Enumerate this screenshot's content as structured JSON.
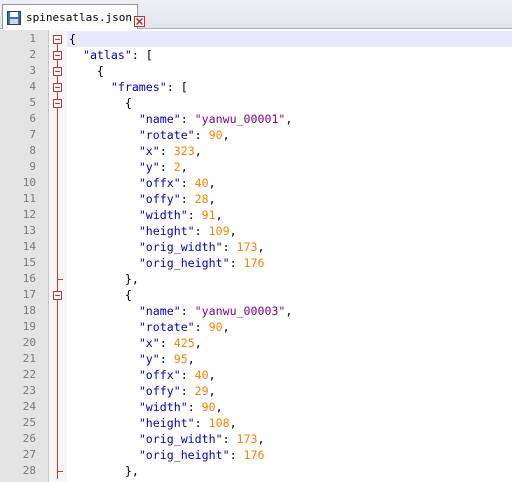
{
  "tab": {
    "filename": "spinesatlas.json",
    "icon": "save-disk-icon",
    "close_icon": "close-x-icon"
  },
  "colors": {
    "key": "#0000c8",
    "string": "#7f007f",
    "number": "#ff7f00",
    "fold": "#e03030"
  },
  "lines": [
    {
      "n": "1",
      "tokens": [
        {
          "t": "{",
          "c": "p"
        }
      ]
    },
    {
      "n": "2",
      "tokens": [
        {
          "t": "  ",
          "c": "p"
        },
        {
          "t": "\"atlas\"",
          "c": "k"
        },
        {
          "t": ": [",
          "c": "p"
        }
      ]
    },
    {
      "n": "3",
      "tokens": [
        {
          "t": "    {",
          "c": "p"
        }
      ]
    },
    {
      "n": "4",
      "tokens": [
        {
          "t": "      ",
          "c": "p"
        },
        {
          "t": "\"frames\"",
          "c": "k"
        },
        {
          "t": ": [",
          "c": "p"
        }
      ]
    },
    {
      "n": "5",
      "tokens": [
        {
          "t": "        {",
          "c": "p"
        }
      ]
    },
    {
      "n": "6",
      "tokens": [
        {
          "t": "          ",
          "c": "p"
        },
        {
          "t": "\"name\"",
          "c": "k"
        },
        {
          "t": ": ",
          "c": "p"
        },
        {
          "t": "\"yanwu_00001\"",
          "c": "s"
        },
        {
          "t": ",",
          "c": "p"
        }
      ]
    },
    {
      "n": "7",
      "tokens": [
        {
          "t": "          ",
          "c": "p"
        },
        {
          "t": "\"rotate\"",
          "c": "k"
        },
        {
          "t": ": ",
          "c": "p"
        },
        {
          "t": "90",
          "c": "n"
        },
        {
          "t": ",",
          "c": "p"
        }
      ]
    },
    {
      "n": "8",
      "tokens": [
        {
          "t": "          ",
          "c": "p"
        },
        {
          "t": "\"x\"",
          "c": "k"
        },
        {
          "t": ": ",
          "c": "p"
        },
        {
          "t": "323",
          "c": "n"
        },
        {
          "t": ",",
          "c": "p"
        }
      ]
    },
    {
      "n": "9",
      "tokens": [
        {
          "t": "          ",
          "c": "p"
        },
        {
          "t": "\"y\"",
          "c": "k"
        },
        {
          "t": ": ",
          "c": "p"
        },
        {
          "t": "2",
          "c": "n"
        },
        {
          "t": ",",
          "c": "p"
        }
      ]
    },
    {
      "n": "10",
      "tokens": [
        {
          "t": "          ",
          "c": "p"
        },
        {
          "t": "\"offx\"",
          "c": "k"
        },
        {
          "t": ": ",
          "c": "p"
        },
        {
          "t": "40",
          "c": "n"
        },
        {
          "t": ",",
          "c": "p"
        }
      ]
    },
    {
      "n": "11",
      "tokens": [
        {
          "t": "          ",
          "c": "p"
        },
        {
          "t": "\"offy\"",
          "c": "k"
        },
        {
          "t": ": ",
          "c": "p"
        },
        {
          "t": "28",
          "c": "n"
        },
        {
          "t": ",",
          "c": "p"
        }
      ]
    },
    {
      "n": "12",
      "tokens": [
        {
          "t": "          ",
          "c": "p"
        },
        {
          "t": "\"width\"",
          "c": "k"
        },
        {
          "t": ": ",
          "c": "p"
        },
        {
          "t": "91",
          "c": "n"
        },
        {
          "t": ",",
          "c": "p"
        }
      ]
    },
    {
      "n": "13",
      "tokens": [
        {
          "t": "          ",
          "c": "p"
        },
        {
          "t": "\"height\"",
          "c": "k"
        },
        {
          "t": ": ",
          "c": "p"
        },
        {
          "t": "109",
          "c": "n"
        },
        {
          "t": ",",
          "c": "p"
        }
      ]
    },
    {
      "n": "14",
      "tokens": [
        {
          "t": "          ",
          "c": "p"
        },
        {
          "t": "\"orig_width\"",
          "c": "k"
        },
        {
          "t": ": ",
          "c": "p"
        },
        {
          "t": "173",
          "c": "n"
        },
        {
          "t": ",",
          "c": "p"
        }
      ]
    },
    {
      "n": "15",
      "tokens": [
        {
          "t": "          ",
          "c": "p"
        },
        {
          "t": "\"orig_height\"",
          "c": "k"
        },
        {
          "t": ": ",
          "c": "p"
        },
        {
          "t": "176",
          "c": "n"
        }
      ]
    },
    {
      "n": "16",
      "tokens": [
        {
          "t": "        },",
          "c": "p"
        }
      ]
    },
    {
      "n": "17",
      "tokens": [
        {
          "t": "        {",
          "c": "p"
        }
      ]
    },
    {
      "n": "18",
      "tokens": [
        {
          "t": "          ",
          "c": "p"
        },
        {
          "t": "\"name\"",
          "c": "k"
        },
        {
          "t": ": ",
          "c": "p"
        },
        {
          "t": "\"yanwu_00003\"",
          "c": "s"
        },
        {
          "t": ",",
          "c": "p"
        }
      ]
    },
    {
      "n": "19",
      "tokens": [
        {
          "t": "          ",
          "c": "p"
        },
        {
          "t": "\"rotate\"",
          "c": "k"
        },
        {
          "t": ": ",
          "c": "p"
        },
        {
          "t": "90",
          "c": "n"
        },
        {
          "t": ",",
          "c": "p"
        }
      ]
    },
    {
      "n": "20",
      "tokens": [
        {
          "t": "          ",
          "c": "p"
        },
        {
          "t": "\"x\"",
          "c": "k"
        },
        {
          "t": ": ",
          "c": "p"
        },
        {
          "t": "425",
          "c": "n"
        },
        {
          "t": ",",
          "c": "p"
        }
      ]
    },
    {
      "n": "21",
      "tokens": [
        {
          "t": "          ",
          "c": "p"
        },
        {
          "t": "\"y\"",
          "c": "k"
        },
        {
          "t": ": ",
          "c": "p"
        },
        {
          "t": "95",
          "c": "n"
        },
        {
          "t": ",",
          "c": "p"
        }
      ]
    },
    {
      "n": "22",
      "tokens": [
        {
          "t": "          ",
          "c": "p"
        },
        {
          "t": "\"offx\"",
          "c": "k"
        },
        {
          "t": ": ",
          "c": "p"
        },
        {
          "t": "40",
          "c": "n"
        },
        {
          "t": ",",
          "c": "p"
        }
      ]
    },
    {
      "n": "23",
      "tokens": [
        {
          "t": "          ",
          "c": "p"
        },
        {
          "t": "\"offy\"",
          "c": "k"
        },
        {
          "t": ": ",
          "c": "p"
        },
        {
          "t": "29",
          "c": "n"
        },
        {
          "t": ",",
          "c": "p"
        }
      ]
    },
    {
      "n": "24",
      "tokens": [
        {
          "t": "          ",
          "c": "p"
        },
        {
          "t": "\"width\"",
          "c": "k"
        },
        {
          "t": ": ",
          "c": "p"
        },
        {
          "t": "90",
          "c": "n"
        },
        {
          "t": ",",
          "c": "p"
        }
      ]
    },
    {
      "n": "25",
      "tokens": [
        {
          "t": "          ",
          "c": "p"
        },
        {
          "t": "\"height\"",
          "c": "k"
        },
        {
          "t": ": ",
          "c": "p"
        },
        {
          "t": "108",
          "c": "n"
        },
        {
          "t": ",",
          "c": "p"
        }
      ]
    },
    {
      "n": "26",
      "tokens": [
        {
          "t": "          ",
          "c": "p"
        },
        {
          "t": "\"orig_width\"",
          "c": "k"
        },
        {
          "t": ": ",
          "c": "p"
        },
        {
          "t": "173",
          "c": "n"
        },
        {
          "t": ",",
          "c": "p"
        }
      ]
    },
    {
      "n": "27",
      "tokens": [
        {
          "t": "          ",
          "c": "p"
        },
        {
          "t": "\"orig_height\"",
          "c": "k"
        },
        {
          "t": ": ",
          "c": "p"
        },
        {
          "t": "176",
          "c": "n"
        }
      ]
    },
    {
      "n": "28",
      "tokens": [
        {
          "t": "        },",
          "c": "p"
        }
      ]
    }
  ],
  "fold_open_lines": [
    "1",
    "2",
    "3",
    "4",
    "5",
    "17"
  ],
  "fold_end_lines": [
    "16",
    "28"
  ]
}
